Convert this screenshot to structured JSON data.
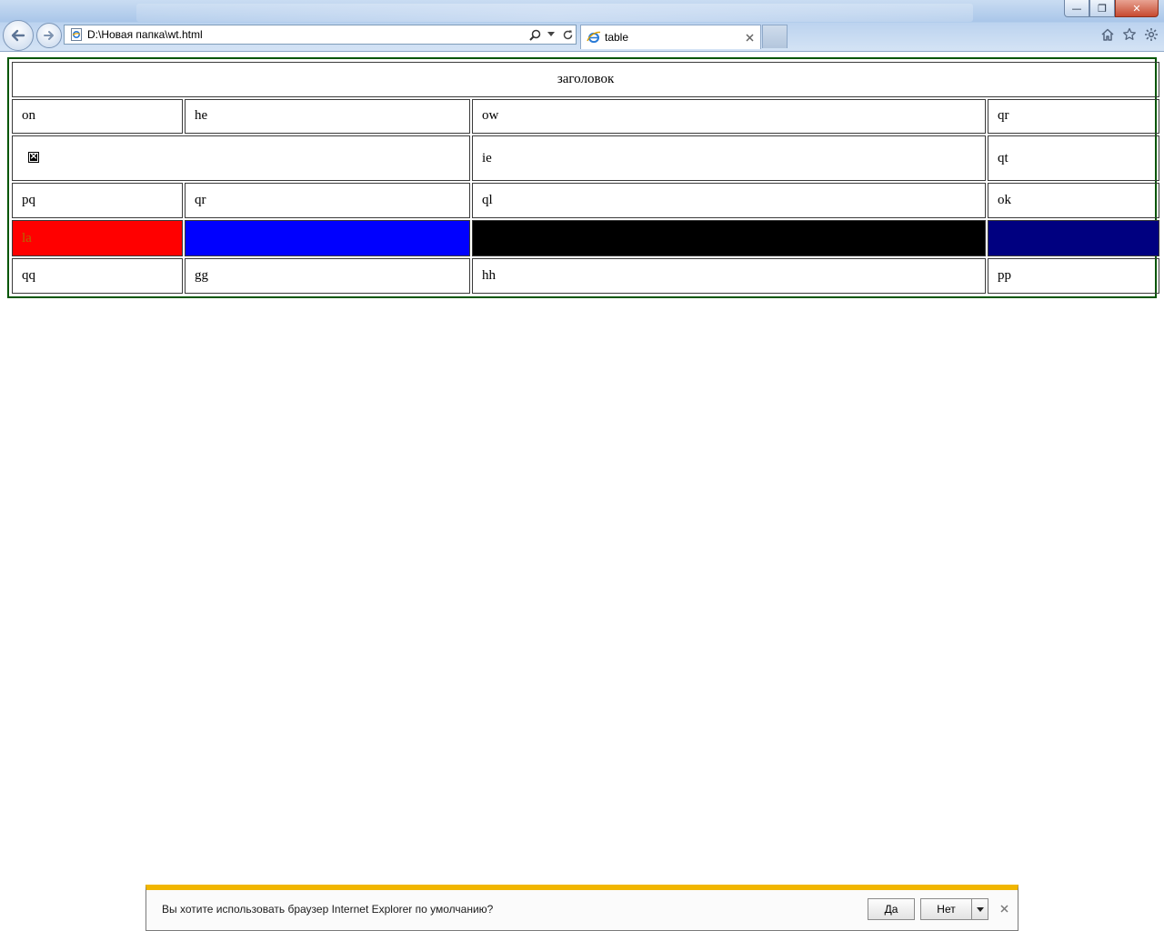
{
  "browser": {
    "address": "D:\\Новая папка\\wt.html",
    "tab_title": "table",
    "window_buttons": {
      "minimize": "—",
      "restore": "❐",
      "close": "✕"
    }
  },
  "table": {
    "header": "заголовок",
    "rows": [
      [
        "on",
        "he",
        "ow",
        "qr"
      ],
      [
        "",
        "ie",
        "qt"
      ],
      [
        "pq",
        "qr",
        "ql",
        "ok"
      ],
      [
        "la",
        "",
        "",
        ""
      ],
      [
        "qq",
        "gg",
        "hh",
        "pp"
      ]
    ],
    "colors": {
      "border": "#005500",
      "red": "#ff0000",
      "blue": "#0000ff",
      "black": "#000000",
      "navy": "#000080"
    }
  },
  "notification": {
    "text": "Вы хотите использовать браузер Internet Explorer по умолчанию?",
    "yes": "Да",
    "no": "Нет",
    "accent": "#f1b600"
  }
}
